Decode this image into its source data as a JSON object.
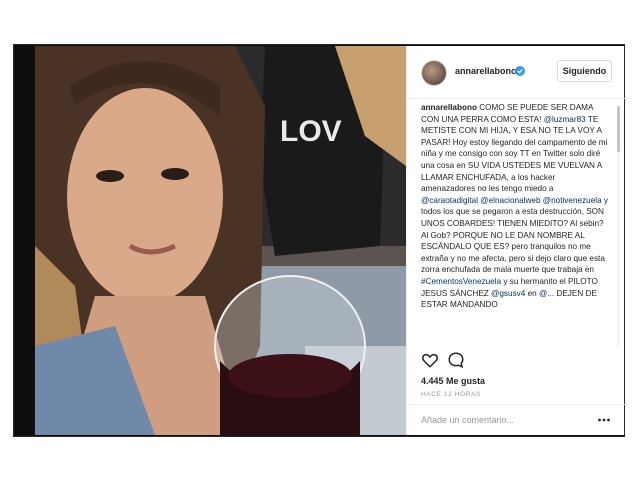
{
  "post": {
    "username": "annarellabono",
    "follow_label": "Siguiendo",
    "likes": "4.445 Me gusta",
    "time_ago": "HACE 12 HORAS",
    "comment_placeholder": "Añade un comentario...",
    "photo_shirt_text": "LOV",
    "caption": {
      "author": "annarellabono",
      "text1": " COMO SE PUEDE SER DAMA CON UNA PERRA COMO ESTA! ",
      "tag1": "@luzmar83",
      "text2": " TE METISTE CON MI HIJA, Y ESA NO TE LA VOY A PASAR! Hoy estoy llegando del campamento de mi niña y me consigo con soy TT en Twitter solo diré una cosa en SU VIDA USTEDES ME VUELVAN A LLAMAR ENCHUFADA, a los hacker amenazadores no les tengo miedo a ",
      "tag2": "@carаotadigital",
      "tag3": "@elnacionalweb",
      "tag4": "@notivenezuela",
      "text3": " y todos los que se pegaron a esta destrucción, SON UNOS COBARDES! TIENEN MIEDITO? Al sebin? Al Gob? PORQUE NO LE DAN NOMBRE AL ESCÁNDALO QUE ES? pero tranquilos no me extraña y no me afecta, pero si dejo claro que esta zorra enchufada de mala muerte que trabaja en ",
      "tag5": "#CementosVenezuela",
      "text4": " y su hermanito el PILOTO JESUS SÁNCHEZ ",
      "tag6": "@gsusv4",
      "text5": " en ",
      "tag7": "@...",
      "text6": " DEJEN DE ESTAR MANDANDO"
    }
  },
  "icons": {
    "verified": "verified-badge-icon",
    "like": "heart-icon",
    "comment": "speech-bubble-icon",
    "more": "ellipsis-icon"
  },
  "colors": {
    "verified": "#3897f0",
    "link": "#003569",
    "button_border": "#dbdbdb",
    "muted": "#999999"
  }
}
